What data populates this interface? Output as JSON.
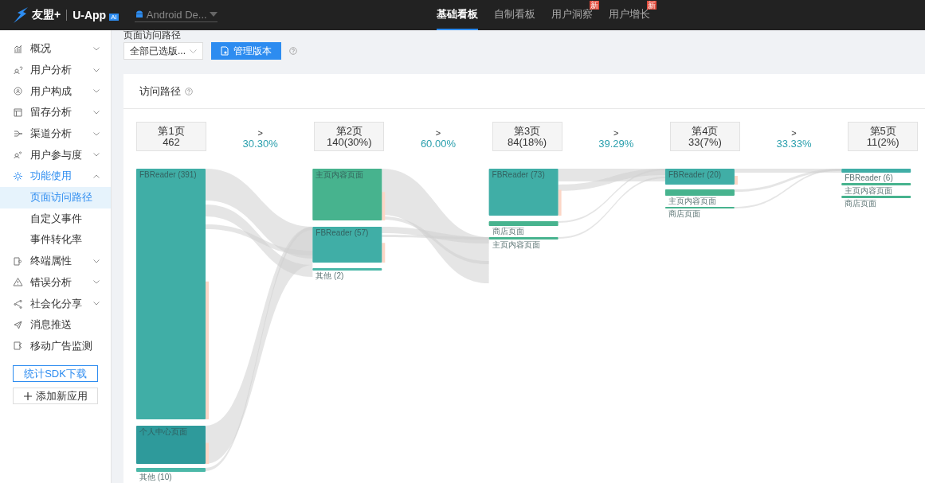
{
  "header": {
    "brand": "友盟+",
    "product": "U-App",
    "product_badge": "AI",
    "app_selector": "Android De...",
    "tabs": [
      {
        "label": "基础看板",
        "selected": true
      },
      {
        "label": "自制看板",
        "selected": false
      },
      {
        "label": "用户洞察",
        "selected": false,
        "badge": "新"
      },
      {
        "label": "用户增长",
        "selected": false,
        "badge": "新"
      }
    ]
  },
  "sidebar": {
    "items": [
      {
        "label": "概况",
        "expanded": false
      },
      {
        "label": "用户分析",
        "expanded": false
      },
      {
        "label": "用户构成",
        "expanded": false
      },
      {
        "label": "留存分析",
        "expanded": false
      },
      {
        "label": "渠道分析",
        "expanded": false
      },
      {
        "label": "用户参与度",
        "expanded": false
      },
      {
        "label": "功能使用",
        "expanded": true,
        "children": [
          {
            "label": "页面访问路径",
            "selected": true
          },
          {
            "label": "自定义事件",
            "selected": false
          },
          {
            "label": "事件转化率",
            "selected": false
          }
        ]
      },
      {
        "label": "终端属性",
        "expanded": false
      },
      {
        "label": "错误分析",
        "expanded": false
      },
      {
        "label": "社会化分享",
        "expanded": false
      },
      {
        "label": "消息推送"
      },
      {
        "label": "移动广告监测"
      }
    ],
    "buttons": [
      {
        "label": "统计SDK下载",
        "kind": "primary"
      },
      {
        "label": "添加新应用",
        "kind": "add"
      }
    ]
  },
  "page_title": "页面访问路径",
  "toolbar": {
    "version_select": "全部已选版...",
    "manage_button": "管理版本"
  },
  "path_card": {
    "title": "访问路径",
    "steps": [
      {
        "label": "第1页",
        "count": "462"
      },
      {
        "label": "第2页",
        "count": "140(30%)"
      },
      {
        "label": "第3页",
        "count": "84(18%)"
      },
      {
        "label": "第4页",
        "count": "33(7%)"
      },
      {
        "label": "第5页",
        "count": "11(2%)"
      }
    ],
    "rates": [
      {
        "arrow": ">",
        "value": "30.30%"
      },
      {
        "arrow": ">",
        "value": "60.00%"
      },
      {
        "arrow": ">",
        "value": "39.29%"
      },
      {
        "arrow": ">",
        "value": "33.33%"
      }
    ],
    "columns": [
      {
        "nodes": [
          {
            "label": "FBReader (391)",
            "color": "#40aea6"
          },
          {
            "label": "个人中心页面",
            "color": "#2e9a9b"
          },
          {
            "label": "其他 (10)",
            "color": "#4bb8a8"
          }
        ]
      },
      {
        "nodes": [
          {
            "label": "主页内容页面",
            "color": "#47b38e"
          },
          {
            "label": "FBReader (57)",
            "color": "#40aea6"
          },
          {
            "label": "其他 (2)",
            "color": "#4bb8a8"
          }
        ]
      },
      {
        "nodes": [
          {
            "label": "FBReader (73)",
            "color": "#40aea6"
          },
          {
            "label": "商店页面",
            "color": "#47b38e"
          },
          {
            "label": "主页内容页面",
            "color": "#47b38e"
          }
        ]
      },
      {
        "nodes": [
          {
            "label": "FBReader (20)",
            "color": "#40aea6"
          },
          {
            "label": "主页内容页面",
            "color": "#47b38e"
          },
          {
            "label": "商店页面",
            "color": "#47b38e"
          }
        ]
      },
      {
        "nodes": [
          {
            "label": "FBReader (6)",
            "color": "#40aea6"
          },
          {
            "label": "主页内容页面",
            "color": "#47b38e"
          },
          {
            "label": "商店页面",
            "color": "#47b38e"
          }
        ]
      }
    ]
  }
}
